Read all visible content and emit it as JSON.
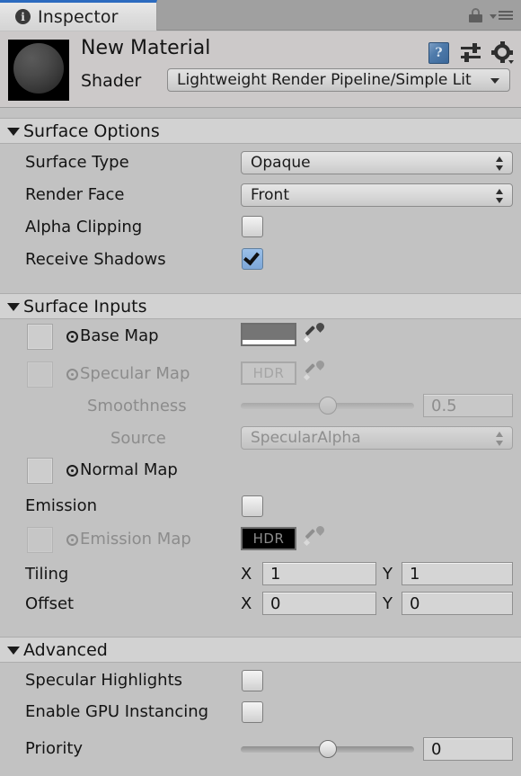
{
  "window": {
    "tab_label": "Inspector",
    "tab_icon": "info-icon",
    "lock_icon": "lock-icon",
    "menu_icon": "hamburger-menu-icon"
  },
  "material": {
    "name": "New Material",
    "shader_label": "Shader",
    "shader_value": "Lightweight Render Pipeline/Simple Lit",
    "preview_icon": "material-sphere-preview",
    "help_icon": "help-book-icon",
    "preset_icon": "preset-sliders-icon",
    "gear_icon": "gear-icon"
  },
  "sections": {
    "surface_options": {
      "title": "Surface Options",
      "surface_type": {
        "label": "Surface Type",
        "value": "Opaque"
      },
      "render_face": {
        "label": "Render Face",
        "value": "Front"
      },
      "alpha_clipping": {
        "label": "Alpha Clipping",
        "checked": false
      },
      "receive_shadows": {
        "label": "Receive Shadows",
        "checked": true
      }
    },
    "surface_inputs": {
      "title": "Surface Inputs",
      "base_map": {
        "label": "Base Map",
        "color": "#757575",
        "alpha": "#ffffff"
      },
      "specular_map": {
        "label": "Specular Map",
        "hdr_label": "HDR",
        "disabled": true
      },
      "smoothness": {
        "label": "Smoothness",
        "value": "0.5",
        "percent": 50,
        "disabled": true
      },
      "source": {
        "label": "Source",
        "value": "SpecularAlpha",
        "disabled": true
      },
      "normal_map": {
        "label": "Normal Map"
      },
      "emission": {
        "label": "Emission",
        "checked": false
      },
      "emission_map": {
        "label": "Emission Map",
        "hdr_label": "HDR",
        "color": "#000000",
        "disabled": true
      },
      "tiling": {
        "label": "Tiling",
        "x_label": "X",
        "x": "1",
        "y_label": "Y",
        "y": "1"
      },
      "offset": {
        "label": "Offset",
        "x_label": "X",
        "x": "0",
        "y_label": "Y",
        "y": "0"
      }
    },
    "advanced": {
      "title": "Advanced",
      "specular_highlights": {
        "label": "Specular Highlights",
        "checked": false
      },
      "gpu_instancing": {
        "label": "Enable GPU Instancing",
        "checked": false
      },
      "priority": {
        "label": "Priority",
        "value": "0",
        "percent": 50
      }
    }
  }
}
